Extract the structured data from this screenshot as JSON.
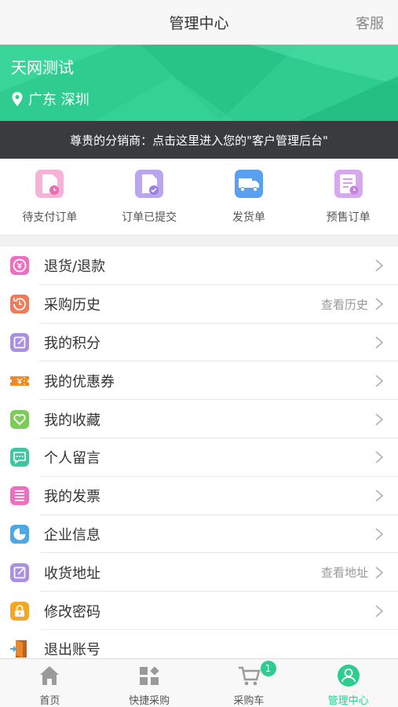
{
  "header": {
    "title": "管理中心",
    "service_label": "客服"
  },
  "profile": {
    "name": "天网测试",
    "location": "广东 深圳",
    "banner_color": "#2ecc8f"
  },
  "notice": {
    "text": "尊贵的分销商：点击这里进入您的\"客户管理后台\""
  },
  "orders": [
    {
      "label": "待支付订单",
      "icon": "pending-payment-icon",
      "color": "#f06ab2"
    },
    {
      "label": "订单已提交",
      "icon": "order-submitted-icon",
      "color": "#9b7fe0"
    },
    {
      "label": "发货单",
      "icon": "delivery-truck-icon",
      "color": "#5aa0f0"
    },
    {
      "label": "预售订单",
      "icon": "presale-order-icon",
      "color": "#c77fe0"
    }
  ],
  "menu": [
    {
      "label": "退货/退款",
      "extra": "",
      "icon": "refund-icon",
      "color": "#ee6fc0"
    },
    {
      "label": "采购历史",
      "extra": "查看历史",
      "icon": "history-icon",
      "color": "#f07a5a"
    },
    {
      "label": "我的积分",
      "extra": "",
      "icon": "points-icon",
      "color": "#a98fe6"
    },
    {
      "label": "我的优惠券",
      "extra": "",
      "icon": "coupon-icon",
      "color": "#f08a24"
    },
    {
      "label": "我的收藏",
      "extra": "",
      "icon": "favorite-icon",
      "color": "#7dcc5a"
    },
    {
      "label": "个人留言",
      "extra": "",
      "icon": "message-icon",
      "color": "#3fc6a0"
    },
    {
      "label": "我的发票",
      "extra": "",
      "icon": "invoice-icon",
      "color": "#ee6fc0"
    },
    {
      "label": "企业信息",
      "extra": "",
      "icon": "company-info-icon",
      "color": "#4aa8e8"
    },
    {
      "label": "收货地址",
      "extra": "查看地址",
      "icon": "address-icon",
      "color": "#a98fe6"
    },
    {
      "label": "修改密码",
      "extra": "",
      "icon": "password-icon",
      "color": "#f5a623"
    },
    {
      "label": "退出账号",
      "extra": "",
      "icon": "logout-icon",
      "color": "#e8872d"
    }
  ],
  "tabs": [
    {
      "label": "首页",
      "icon": "home-icon",
      "active": false
    },
    {
      "label": "快捷采购",
      "icon": "quick-purchase-icon",
      "active": false
    },
    {
      "label": "采购车",
      "icon": "cart-icon",
      "active": false,
      "badge": "1"
    },
    {
      "label": "管理中心",
      "icon": "user-center-icon",
      "active": true
    }
  ],
  "accent_color": "#2ecc8f"
}
